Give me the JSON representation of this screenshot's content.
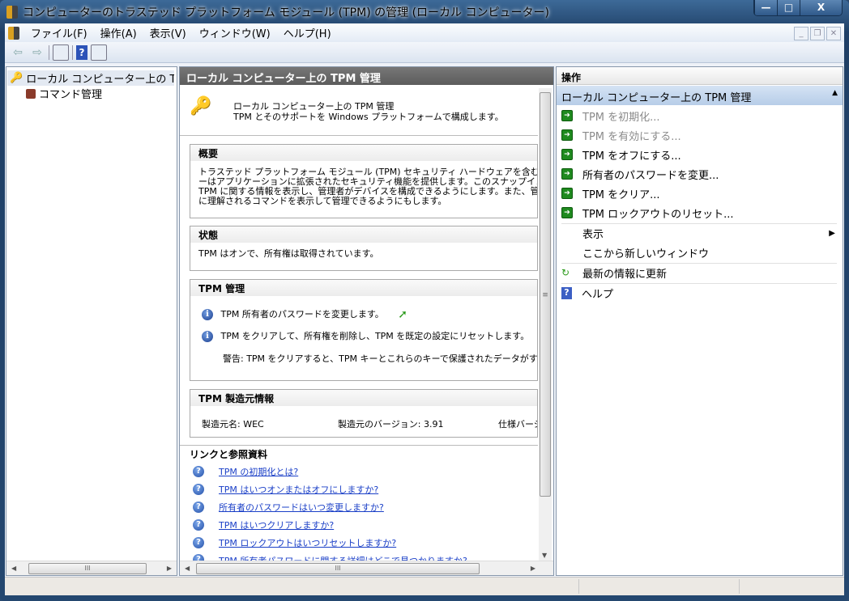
{
  "window": {
    "title": "コンピューターのトラステッド プラットフォーム モジュール (TPM) の管理 (ローカル コンピューター)",
    "minimize": "—",
    "maximize": "□",
    "close": "X"
  },
  "menu": [
    "ファイル(F)",
    "操作(A)",
    "表示(V)",
    "ウィンドウ(W)",
    "ヘルプ(H)"
  ],
  "tree": {
    "root": "ローカル コンピューター上の TPM 管理",
    "child": "コマンド管理"
  },
  "center": {
    "header": "ローカル コンピューター上の TPM 管理",
    "intro_title": "ローカル コンピューター上の TPM 管理",
    "intro_sub": "TPM とそのサポートを Windows プラットフォームで構成します。",
    "overview": {
      "title": "概要",
      "lines": [
        "トラステッド プラットフォーム モジュール (TPM) セキュリティ ハードウェアを含む Windows コン",
        "ーはアプリケーションに拡張されたセキュリティ機能を提供します。このスナップインは、コンピュ",
        "TPM に関する情報を表示し、管理者がデバイスを構成できるようにします。また、管理者が",
        "に理解されるコマンドを表示して管理できるようにもします。"
      ]
    },
    "status": {
      "title": "状態",
      "text": "TPM はオンで、所有権は取得されています。"
    },
    "management": {
      "title": "TPM 管理",
      "item1": "TPM 所有者のパスワードを変更します。",
      "item2": "TPM をクリアして、所有権を削除し、TPM を既定の設定にリセットします。",
      "warning": "警告: TPM をクリアすると、TPM キーとこれらのキーで保護されたデータがすべて失わ"
    },
    "manufacturer": {
      "title": "TPM 製造元情報",
      "name": "製造元名: WEC",
      "version": "製造元のバージョン: 3.91",
      "spec": "仕様バージ"
    },
    "links": {
      "title": "リンクと参照資料",
      "items": [
        "TPM の初期化とは?",
        "TPM はいつオンまたはオフにしますか?",
        "所有者のパスワードはいつ変更しますか?",
        "TPM はいつクリアしますか?",
        "TPM ロックアウトはいつリセットしますか?",
        "TPM 所有者パスワードに関する詳細はどこで見つかりますか?"
      ]
    }
  },
  "actions": {
    "header": "操作",
    "group": "ローカル コンピューター上の TPM 管理",
    "items": [
      {
        "label": "TPM を初期化...",
        "disabled": true
      },
      {
        "label": "TPM を有効にする...",
        "disabled": true
      },
      {
        "label": "TPM をオフにする...",
        "disabled": false
      },
      {
        "label": "所有者のパスワードを変更...",
        "disabled": false
      },
      {
        "label": "TPM をクリア...",
        "disabled": false
      },
      {
        "label": "TPM ロックアウトのリセット...",
        "disabled": false
      }
    ],
    "view": "表示",
    "new_window": "ここから新しいウィンドウ",
    "refresh": "最新の情報に更新",
    "help": "ヘルプ"
  },
  "colors": {
    "accent": "#1f8a1f",
    "link": "#1a3fc7",
    "header": "#5c5c5c"
  }
}
